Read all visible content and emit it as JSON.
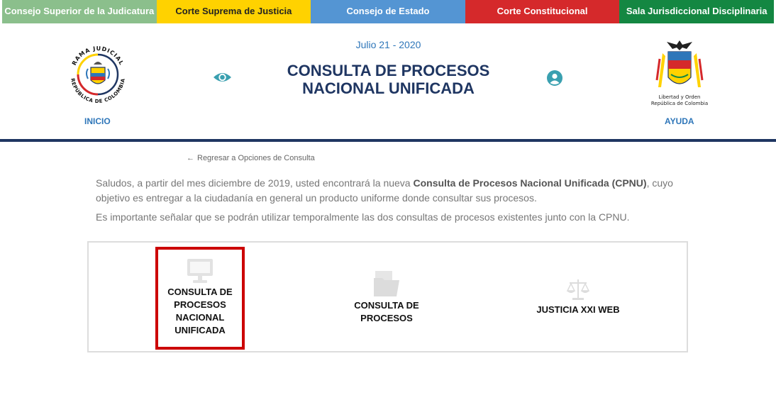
{
  "top_tabs": [
    {
      "label": "Consejo Superior de la Judicatura",
      "color": "#8bbf8c"
    },
    {
      "label": "Corte Suprema de Justicia",
      "color": "#ffd200"
    },
    {
      "label": "Consejo de Estado",
      "color": "#5495d3"
    },
    {
      "label": "Corte Constitucional",
      "color": "#d5292b"
    },
    {
      "label": "Sala Jurisdiccional Disciplinaria",
      "color": "#148742"
    }
  ],
  "header": {
    "date": "Julio 21 - 2020",
    "title_line1": "CONSULTA DE PROCESOS",
    "title_line2": "NACIONAL UNIFICADA",
    "left_nav": "INICIO",
    "right_nav": "AYUDA",
    "left_logo_text_top": "RAMA JUDICIAL",
    "left_logo_text_bottom": "REPÚBLICA DE COLOMBIA",
    "right_logo_line1": "Libertad y Orden",
    "right_logo_line2": "República de Colombia",
    "accent_color": "#1f3662",
    "link_color": "#2e76b9",
    "icon_color": "#3aa0b0"
  },
  "back_link": "Regresar a Opciones de Consulta",
  "intro": {
    "p1_before": "Saludos, a partir del mes diciembre de 2019, usted encontrará la nueva ",
    "p1_bold": "Consulta de Procesos Nacional Unificada (CPNU)",
    "p1_after": ", cuyo objetivo es entregar a la ciudadanía en general un producto uniforme donde consultar sus procesos.",
    "p2": "Es importante señalar que se podrán utilizar temporalmente las dos consultas de procesos existentes junto con la CPNU."
  },
  "options": [
    {
      "icon": "monitor-icon",
      "lines": [
        "CONSULTA DE",
        "PROCESOS",
        "NACIONAL",
        "UNIFICADA"
      ],
      "selected": true
    },
    {
      "icon": "folder-icon",
      "lines": [
        "CONSULTA DE",
        "PROCESOS"
      ],
      "selected": false
    },
    {
      "icon": "scales-icon",
      "lines": [
        "JUSTICIA XXI WEB"
      ],
      "selected": false
    }
  ],
  "selected_color": "#cc0000"
}
